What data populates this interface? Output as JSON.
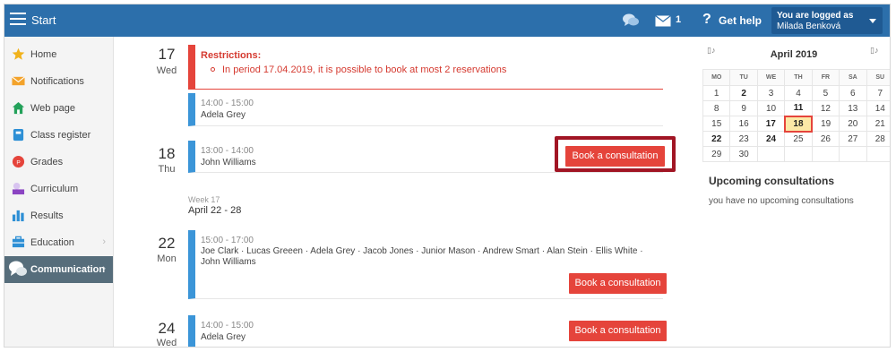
{
  "app": {
    "title": "Start"
  },
  "topbar": {
    "mail_count": "1",
    "help_label": "Get help",
    "user_title": "You are logged as",
    "user_name": "Milada Benková"
  },
  "sidebar": {
    "items": [
      {
        "label": "Home",
        "icon": "star-icon"
      },
      {
        "label": "Notifications",
        "icon": "envelope-icon"
      },
      {
        "label": "Web page",
        "icon": "house-icon"
      },
      {
        "label": "Class register",
        "icon": "register-icon"
      },
      {
        "label": "Grades",
        "icon": "grades-icon"
      },
      {
        "label": "Curriculum",
        "icon": "curriculum-icon"
      },
      {
        "label": "Results",
        "icon": "results-icon"
      },
      {
        "label": "Education",
        "icon": "education-icon"
      },
      {
        "label": "Communication",
        "icon": "communication-icon"
      }
    ],
    "active": "Communication"
  },
  "days": {
    "d17": {
      "num": "17",
      "name": "Wed"
    },
    "d18": {
      "num": "18",
      "name": "Thu"
    },
    "d22": {
      "num": "22",
      "name": "Mon"
    },
    "d24": {
      "num": "24",
      "name": "Wed"
    }
  },
  "restriction": {
    "title": "Restrictions:",
    "text": "In period 17.04.2019, it is possible to book at most 2 reservations"
  },
  "slots": {
    "s1": {
      "time": "14:00 - 15:00",
      "who": "Adela Grey"
    },
    "s2": {
      "time": "13:00 - 14:00",
      "who": "John Williams"
    },
    "s3": {
      "time": "15:00 - 17:00",
      "who": "Joe Clark · Lucas Greeen · Adela Grey · Jacob Jones · Junior Mason · Andrew Smart · Alan Stein · Ellis White · John Williams"
    },
    "s4": {
      "time": "14:00 - 15:00",
      "who": "Adela Grey"
    }
  },
  "week": {
    "label": "Week 17",
    "range": "April 22 - 28"
  },
  "book_label": "Book a consultation",
  "calendar": {
    "title": "April 2019",
    "weekdays": [
      "MO",
      "TU",
      "WE",
      "TH",
      "FR",
      "SA",
      "SU"
    ],
    "days": [
      "1",
      "2",
      "3",
      "4",
      "5",
      "6",
      "7",
      "8",
      "9",
      "10",
      "11",
      "12",
      "13",
      "14",
      "15",
      "16",
      "17",
      "18",
      "19",
      "20",
      "21",
      "22",
      "23",
      "24",
      "25",
      "26",
      "27",
      "28",
      "29",
      "30",
      "",
      "",
      "",
      "",
      ""
    ],
    "bold_days": [
      "2",
      "11",
      "17",
      "22",
      "24"
    ],
    "selected_day": "18"
  },
  "upcoming": {
    "title": "Upcoming consultations",
    "text": "you have no upcoming consultations"
  },
  "colors": {
    "topbar": "#2c6fab",
    "accent_red": "#e5443b",
    "slot_blue": "#3b95d8",
    "highlight_border": "#a11524",
    "selected_day_bg": "#fbe8a6"
  }
}
